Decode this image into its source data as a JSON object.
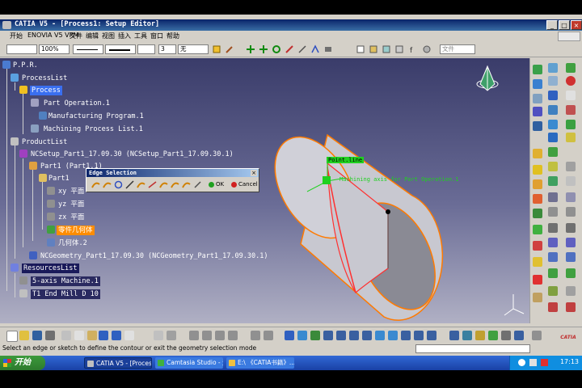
{
  "window": {
    "title": "CATIA V5 - [Process1: Setup Editor]",
    "min_label": "_",
    "max_label": "□",
    "close_label": "×"
  },
  "menu": [
    "开始",
    "ENOVIA V5 VPM",
    "文件",
    "编辑",
    "视图",
    "插入",
    "工具",
    "窗口",
    "帮助"
  ],
  "toolbar": {
    "zoom_value": "100%",
    "layer_value": "无",
    "filter_value": "文件",
    "number_value": "3"
  },
  "tree": {
    "root": "P.P.R.",
    "process_list": "ProcessList",
    "process": "Process",
    "part_operation": "Part Operation.1",
    "manufacturing_program": "Manufacturing Program.1",
    "machining_process_list": "Machining Process List.1",
    "product_list": "ProductList",
    "nc_setup": "NCSetup_Part1_17.09.30 (NCSetup_Part1_17.09.30.1)",
    "part1_instance": "Part1 (Part1.1)",
    "part1": "Part1",
    "xy_plane": "xy 平面",
    "yz_plane": "yz 平面",
    "zx_plane": "zx 平面",
    "body": "零件几何体",
    "geometry_set": "几何体.2",
    "nc_geometry": "NCGeometry_Part1_17.09.30 (NCGeometry_Part1_17.09.30.1)",
    "resources_list": "ResourcesList",
    "machine": "5-axis Machine.1",
    "tool": "T1 End Mill D 10"
  },
  "dialog": {
    "title": "Edge Selection",
    "ok_label": "OK",
    "cancel_label": "Cancel",
    "close_label": "×"
  },
  "viewport": {
    "label_edge": "Point.line",
    "label_annotation": "Machining axis for Part Operation.1"
  },
  "status": {
    "message": "Select an edge or sketch to define the contour or exit the geometry selection mode"
  },
  "taskbar": {
    "start_label": "开始",
    "tasks": [
      "CATIA V5 - [Process1...",
      "Camtasia Studio - 无...",
      "E:\\ 《CATIA书籍》..."
    ],
    "time": "17:13"
  },
  "colors": {
    "accent": "#3a6ff0",
    "highlight": "#ff8c00",
    "edge_selected": "#ff3030",
    "label_green": "#1fd11f"
  }
}
